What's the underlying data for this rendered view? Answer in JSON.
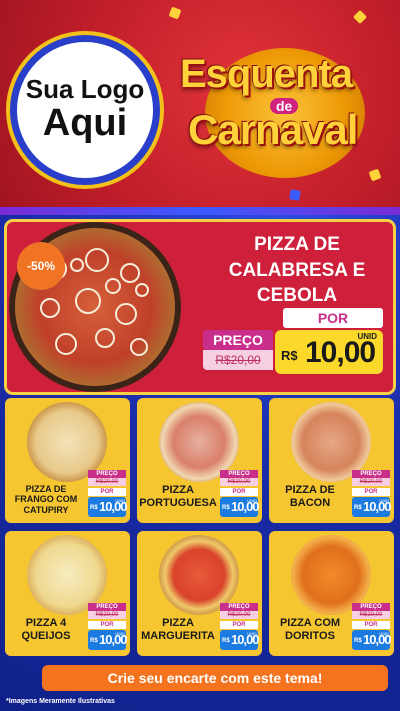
{
  "header": {
    "logo_line1": "Sua Logo",
    "logo_line2": "Aqui",
    "title_line1": "Esquenta",
    "title_de": "de",
    "title_line2": "Carnaval",
    "colors": {
      "header_bg": "#c21f2a",
      "logo_border": "#2a3fc9",
      "title_yellow": "#ffd23a"
    }
  },
  "featured": {
    "discount": "-50%",
    "name": "PIZZA DE CALABRESA E CEBOLA",
    "preco_label": "PREÇO",
    "old_price": "R$20,00",
    "por_label": "POR",
    "currency": "R$",
    "price": "10,00",
    "unit": "UNID"
  },
  "products": [
    {
      "name": "PIZZA DE FRANGO COM CATUPIRY",
      "preco_label": "PREÇO",
      "old_price": "R$20,00",
      "por_label": "POR",
      "currency": "R$",
      "price": "10,00",
      "unit": "UNID",
      "topping": "chicken"
    },
    {
      "name": "PIZZA PORTUGUESA",
      "preco_label": "PREÇO",
      "old_price": "R$20,00",
      "por_label": "POR",
      "currency": "R$",
      "price": "10,00",
      "unit": "UNID",
      "topping": "portuguesa"
    },
    {
      "name": "PIZZA DE BACON",
      "preco_label": "PREÇO",
      "old_price": "R$20,00",
      "por_label": "POR",
      "currency": "R$",
      "price": "10,00",
      "unit": "UNID",
      "topping": "bacon"
    },
    {
      "name": "PIZZA 4 QUEIJOS",
      "preco_label": "PREÇO",
      "old_price": "R$20,00",
      "por_label": "POR",
      "currency": "R$",
      "price": "10,00",
      "unit": "UNID",
      "topping": "cheese"
    },
    {
      "name": "PIZZA MARGUERITA",
      "preco_label": "PREÇO",
      "old_price": "R$20,00",
      "por_label": "POR",
      "currency": "R$",
      "price": "10,00",
      "unit": "UNID",
      "topping": "margherita"
    },
    {
      "name": "PIZZA COM DORITOS",
      "preco_label": "PREÇO",
      "old_price": "R$20,00",
      "por_label": "POR",
      "currency": "R$",
      "price": "10,00",
      "unit": "UNID",
      "topping": "doritos"
    }
  ],
  "footer": {
    "cta_label": "Crie seu encarte com este tema!",
    "disclaimer": "*Imagens Meramente Ilustrativas"
  }
}
